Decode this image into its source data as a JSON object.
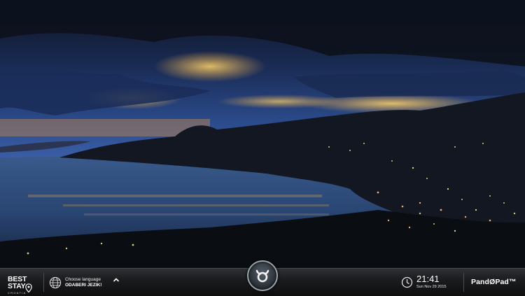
{
  "branding": {
    "logo_line1": "BEST",
    "logo_line2": "STAY",
    "logo_sub": "CROATIA",
    "product": "PandØPad™"
  },
  "language": {
    "line1": "Choose language",
    "line2": "ODABERI JEZIK!"
  },
  "clock": {
    "time": "21:41",
    "date": "Sun Nov 29 2015"
  },
  "icons": [
    "globe-icon",
    "chevron-up-icon",
    "pandopad-home-icon",
    "clock-icon",
    "location-pin-icon"
  ],
  "colors": {
    "bar_bg": "#1b1c1e",
    "text": "#ffffff",
    "sky_glow": "#f5b53a"
  }
}
